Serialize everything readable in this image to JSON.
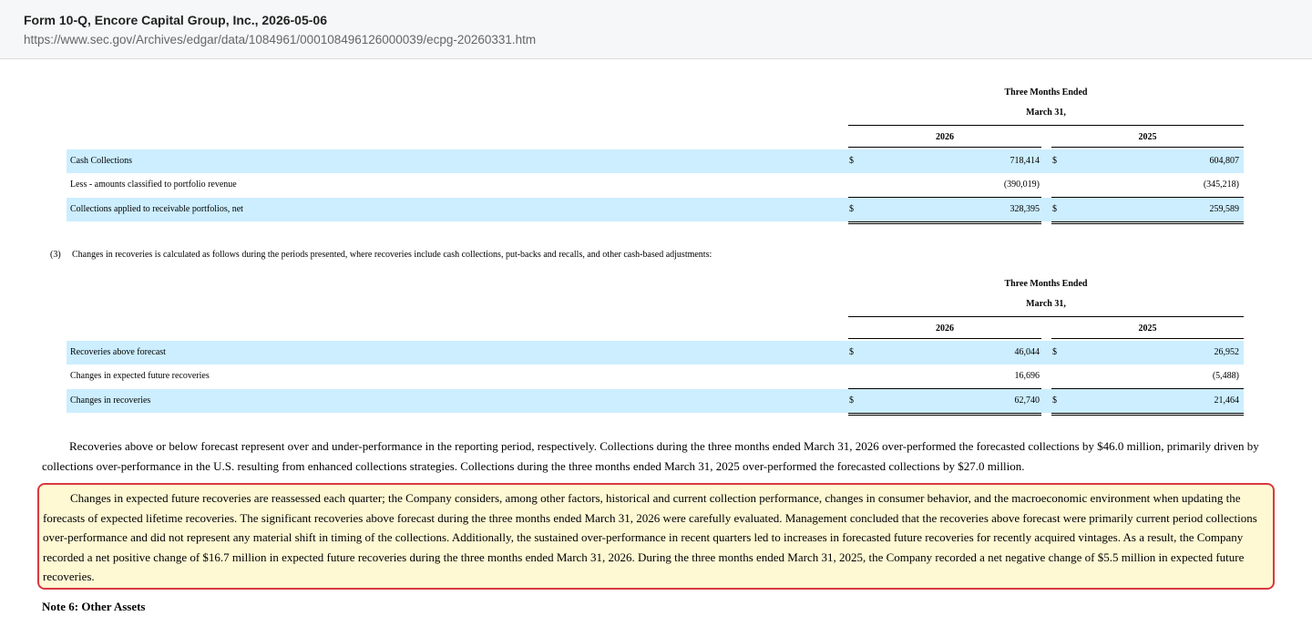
{
  "header": {
    "title": "Form 10-Q, Encore Capital Group, Inc., 2026-05-06",
    "url": "https://www.sec.gov/Archives/edgar/data/1084961/000108496126000039/ecpg-20260331.htm"
  },
  "table1": {
    "period_header": "Three Months Ended",
    "date_header": "March 31,",
    "col1": "2026",
    "col2": "2025",
    "rows": [
      {
        "label": "Cash Collections",
        "dol1": "$",
        "v1": "718,414",
        "dol2": "$",
        "v2": "604,807"
      },
      {
        "label": "Less - amounts classified to portfolio revenue",
        "dol1": "",
        "v1": "(390,019)",
        "dol2": "",
        "v2": "(345,218)"
      },
      {
        "label": "Collections applied to receivable portfolios, net",
        "dol1": "$",
        "v1": "328,395",
        "dol2": "$",
        "v2": "259,589"
      }
    ]
  },
  "footnote": {
    "num": "(3)",
    "text": "Changes in recoveries is calculated as follows during the periods presented, where recoveries include cash collections, put-backs and recalls, and other cash-based adjustments:"
  },
  "table2": {
    "period_header": "Three Months Ended",
    "date_header": "March 31,",
    "col1": "2026",
    "col2": "2025",
    "rows": [
      {
        "label": "Recoveries above forecast",
        "dol1": "$",
        "v1": "46,044",
        "dol2": "$",
        "v2": "26,952"
      },
      {
        "label": "Changes in expected future recoveries",
        "dol1": "",
        "v1": "16,696",
        "dol2": "",
        "v2": "(5,488)"
      },
      {
        "label": "Changes in recoveries",
        "dol1": "$",
        "v1": "62,740",
        "dol2": "$",
        "v2": "21,464"
      }
    ]
  },
  "paragraph1": "Recoveries above or below forecast represent over and under-performance in the reporting period, respectively. Collections during the three months ended March 31, 2026 over-performed the forecasted collections by $46.0 million, primarily driven by collections over-performance in the U.S. resulting from enhanced collections strategies. Collections during the three months ended March 31, 2025 over-performed the forecasted collections by $27.0 million.",
  "paragraph2": "Changes in expected future recoveries are reassessed each quarter; the Company considers, among other factors, historical and current collection performance, changes in consumer behavior, and the macroeconomic environment when updating the forecasts of expected lifetime recoveries. The significant recoveries above forecast during the three months ended March 31, 2026 were carefully evaluated. Management concluded that the recoveries above forecast were primarily current period collections over-performance and did not represent any material shift in timing of the collections. Additionally, the sustained over-performance in recent quarters led to increases in forecasted future recoveries for recently acquired vintages. As a result, the Company recorded a net positive change of $16.7 million in expected future recoveries during the three months ended March 31, 2026. During the three months ended March 31, 2025, the Company recorded a net negative change of $5.5 million in expected future recoveries.",
  "note_heading": "Note 6: Other Assets",
  "colors": {
    "row_shade": "#cceeff",
    "highlight_bg": "#fef8d3",
    "highlight_border": "#d8393f"
  }
}
